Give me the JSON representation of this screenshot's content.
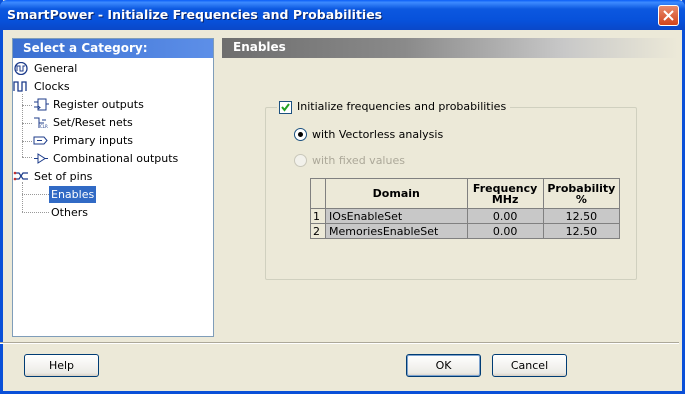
{
  "window": {
    "title": "SmartPower - Initialize Frequencies and Probabilities"
  },
  "sidebar": {
    "header": "Select a Category:",
    "items": [
      {
        "label": "General",
        "icon": "waveform-general-icon"
      },
      {
        "label": "Clocks",
        "icon": "clock-waveform-icon"
      },
      {
        "label": "Register outputs",
        "icon": "register-icon"
      },
      {
        "label": "Set/Reset nets",
        "icon": "set-reset-icon"
      },
      {
        "label": "Primary inputs",
        "icon": "primary-input-icon"
      },
      {
        "label": "Combinational outputs",
        "icon": "combinational-icon"
      },
      {
        "label": "Set of pins",
        "icon": "pin-set-icon"
      },
      {
        "label": "Enables",
        "selected": true
      },
      {
        "label": "Others"
      }
    ]
  },
  "panel": {
    "header": "Enables",
    "init_checkbox_label": "Initialize frequencies and probabilities",
    "init_checked": true,
    "radio_vectorless": "with Vectorless analysis",
    "radio_fixed": "with fixed values",
    "table": {
      "headers": [
        "",
        "Domain",
        "Frequency\nMHz",
        "Probability\n%"
      ],
      "rows": [
        {
          "num": "1",
          "domain": "IOsEnableSet",
          "frequency": "0.00",
          "probability": "12.50"
        },
        {
          "num": "2",
          "domain": "MemoriesEnableSet",
          "frequency": "0.00",
          "probability": "12.50"
        }
      ]
    }
  },
  "buttons": {
    "help": "Help",
    "ok": "OK",
    "cancel": "Cancel"
  }
}
